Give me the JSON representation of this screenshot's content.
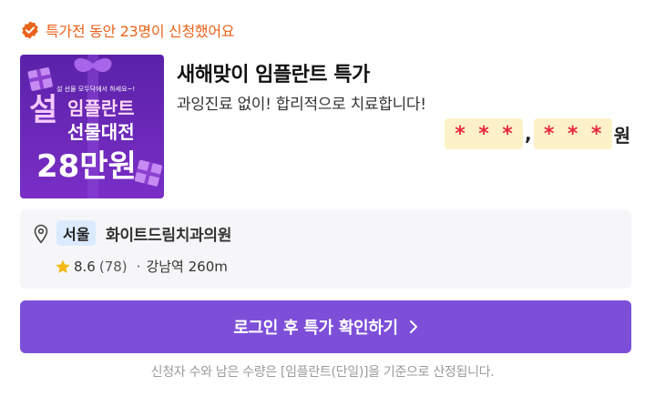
{
  "top_badge": {
    "icon": "check-badge-icon",
    "text": "특가전 동안 23명이 신청했어요",
    "color": "#e8631c"
  },
  "product": {
    "thumbnail": {
      "small_text": "설 선물 모두닥에서 하세요~!",
      "line1_a": "설",
      "line1_b": "임플란트",
      "line2": "선물대전",
      "line3": "28만원"
    },
    "title": "새해맞이 임플란트 특가",
    "subtitle": "과잉진료 없이! 합리적으로 치료합니다!"
  },
  "price": {
    "mask_group_1": [
      "*",
      "*",
      "*"
    ],
    "separator": ",",
    "mask_group_2": [
      "*",
      "*",
      "*"
    ],
    "unit": "원"
  },
  "clinic": {
    "pin_icon": "location-pin-icon",
    "region": "서울",
    "name": "화이트드림치과의원",
    "star_icon": "star-icon",
    "rating": "8.6",
    "reviews": "(78)",
    "dot": "·",
    "distance": "강남역 260m"
  },
  "cta": {
    "label": "로그인 후 특가 확인하기",
    "icon": "chevron-right-icon",
    "color": "#7d4fd9"
  },
  "footnote": "신청자 수와 남은 수량은 [임플란트(단일)]을 기준으로 산정됩니다."
}
